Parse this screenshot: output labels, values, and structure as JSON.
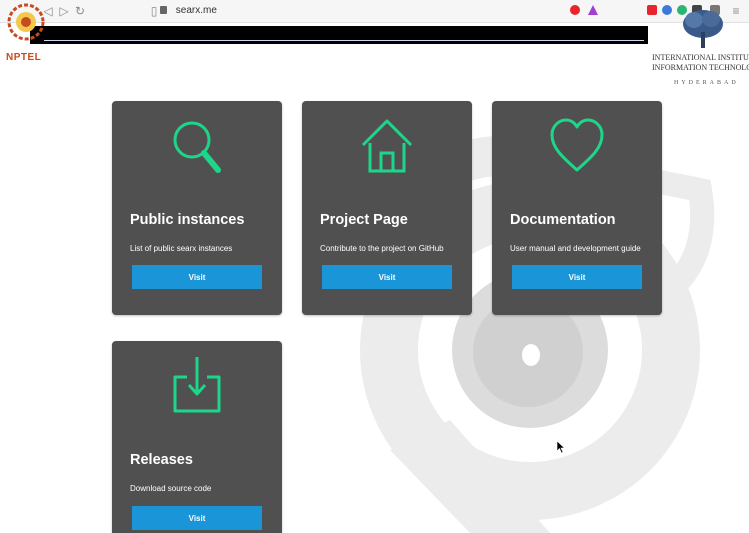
{
  "browser": {
    "url": "searx.me",
    "icons": [
      "back-icon",
      "forward-icon",
      "reload-icon",
      "bookmark-icon",
      "lock-icon"
    ],
    "extension_colors": [
      "#e8242d",
      "#3b7ad9",
      "#29b573",
      "#444444",
      "#555555",
      "#666666"
    ]
  },
  "logos": {
    "left_text": "NPTEL",
    "right_name_line1": "INTERNATIONAL INSTITUTE",
    "right_name_line2": "INFORMATION TECHNOLO",
    "right_city": "HYDERABAD"
  },
  "colors": {
    "card_bg": "#505050",
    "accent_green": "#1ed68a",
    "button_blue": "#1a95d7"
  },
  "cards": [
    {
      "icon": "search-icon",
      "title": "Public instances",
      "description": "List of public searx instances",
      "button": "Visit"
    },
    {
      "icon": "home-icon",
      "title": "Project Page",
      "description": "Contribute to the project on GitHub",
      "button": "Visit"
    },
    {
      "icon": "heart-icon",
      "title": "Documentation",
      "description": "User manual and development guide",
      "button": "Visit"
    },
    {
      "icon": "download-icon",
      "title": "Releases",
      "description": "Download source code",
      "button": "Visit"
    }
  ]
}
